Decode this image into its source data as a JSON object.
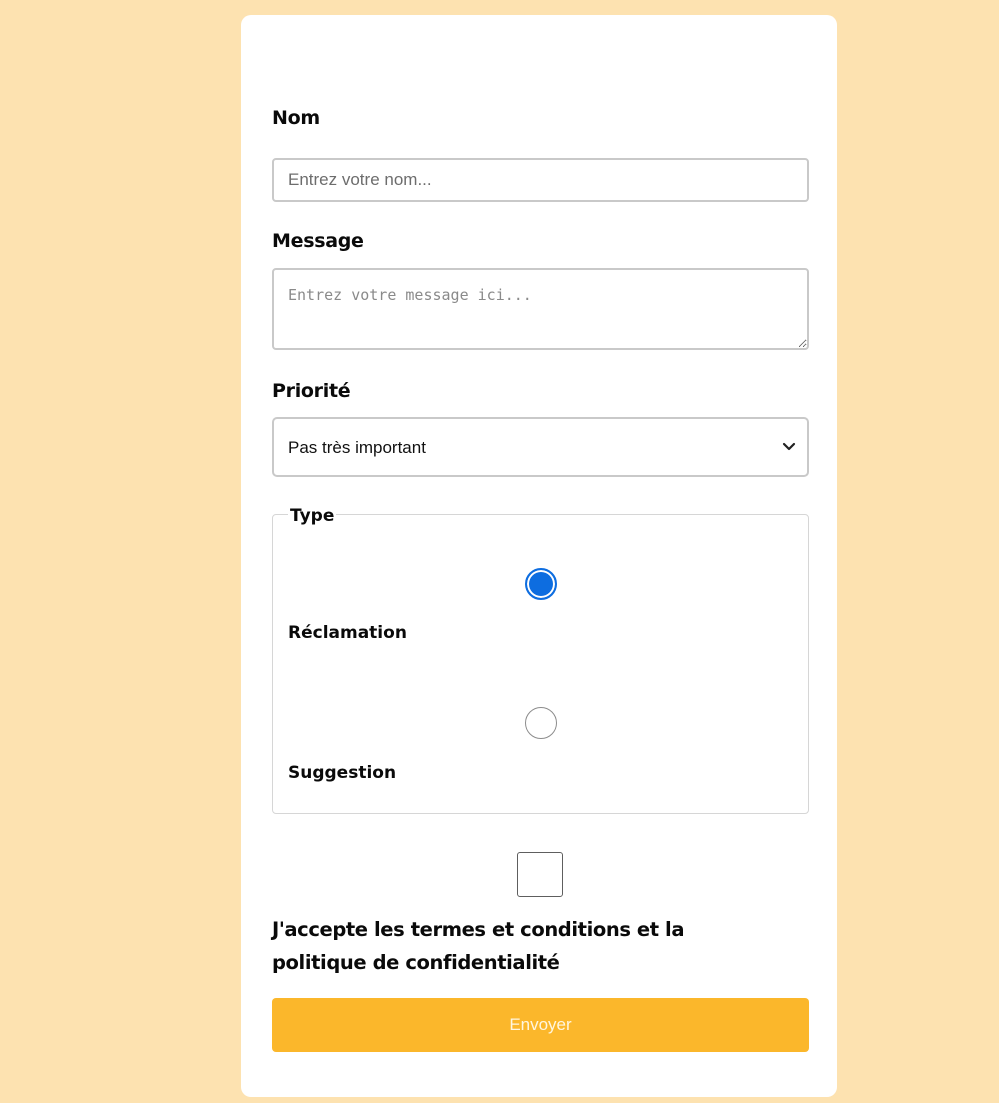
{
  "form": {
    "name_label": "Nom",
    "name_placeholder": "Entrez votre nom...",
    "name_value": "",
    "message_label": "Message",
    "message_placeholder": "Entrez votre message ici...",
    "message_value": "",
    "priority_label": "Priorité",
    "priority_selected": "Pas très important",
    "type_legend": "Type",
    "type_options": [
      {
        "label": "Réclamation",
        "checked": true
      },
      {
        "label": "Suggestion",
        "checked": false
      }
    ],
    "terms_checked": false,
    "terms_label": "J'accepte les termes et conditions et la politique de confidentialité",
    "submit_label": "Envoyer"
  },
  "icons": {
    "priority_dropdown": "chevron-down-icon"
  },
  "colors": {
    "page_background": "#fde2b0",
    "card_background": "#ffffff",
    "submit_background": "#fbb72b",
    "radio_checked": "#0d6de0"
  }
}
